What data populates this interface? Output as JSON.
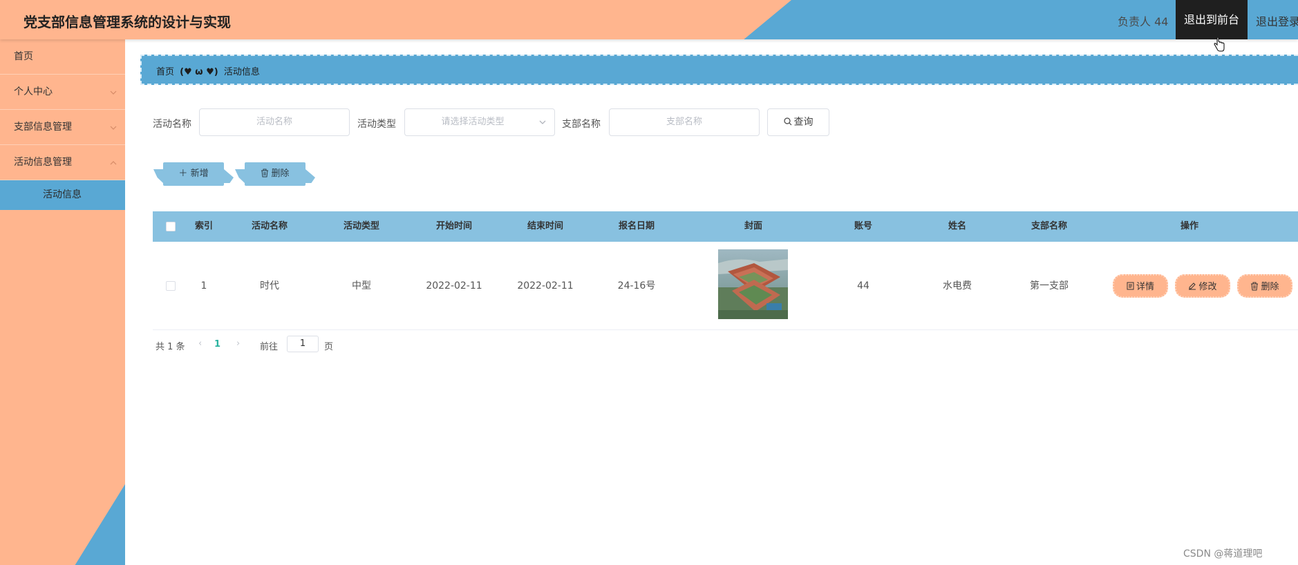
{
  "header": {
    "title": "党支部信息管理系统的设计与实现",
    "user_label": "负责人 44",
    "front_label": "退出到前台",
    "logout_label": "退出登录"
  },
  "sidebar": {
    "items": [
      {
        "label": "首页"
      },
      {
        "label": "个人中心"
      },
      {
        "label": "支部信息管理"
      },
      {
        "label": "活动信息管理"
      }
    ],
    "active_sub": "活动信息"
  },
  "breadcrumb": {
    "home": "首页",
    "separator": "(♥ ω ♥)",
    "current": "活动信息"
  },
  "filters": {
    "activity_name_label": "活动名称",
    "activity_name_placeholder": "活动名称",
    "activity_type_label": "活动类型",
    "activity_type_placeholder": "请选择活动类型",
    "branch_name_label": "支部名称",
    "branch_name_placeholder": "支部名称",
    "query_label": "查询"
  },
  "actions": {
    "add_label": "新增",
    "delete_label": "删除"
  },
  "table": {
    "headers": [
      "索引",
      "活动名称",
      "活动类型",
      "开始时间",
      "结束时间",
      "报名日期",
      "封面",
      "账号",
      "姓名",
      "支部名称",
      "操作"
    ],
    "rows": [
      {
        "index": "1",
        "name": "时代",
        "type": "中型",
        "start": "2022-02-11",
        "end": "2022-02-11",
        "signup": "24-16号",
        "account": "44",
        "person": "水电费",
        "branch": "第一支部"
      }
    ],
    "ops": {
      "detail": "详情",
      "edit": "修改",
      "delete": "删除"
    }
  },
  "pagination": {
    "total": "共 1 条",
    "current_page": "1",
    "goto_label": "前往",
    "goto_value": "1",
    "page_suffix": "页"
  },
  "watermark": "CSDN @蒋道理吧",
  "colors": {
    "salmon": "#ffb58e",
    "blue": "#59a8d4",
    "table_header": "#88c1e0",
    "dark": "#1f1f1f"
  }
}
